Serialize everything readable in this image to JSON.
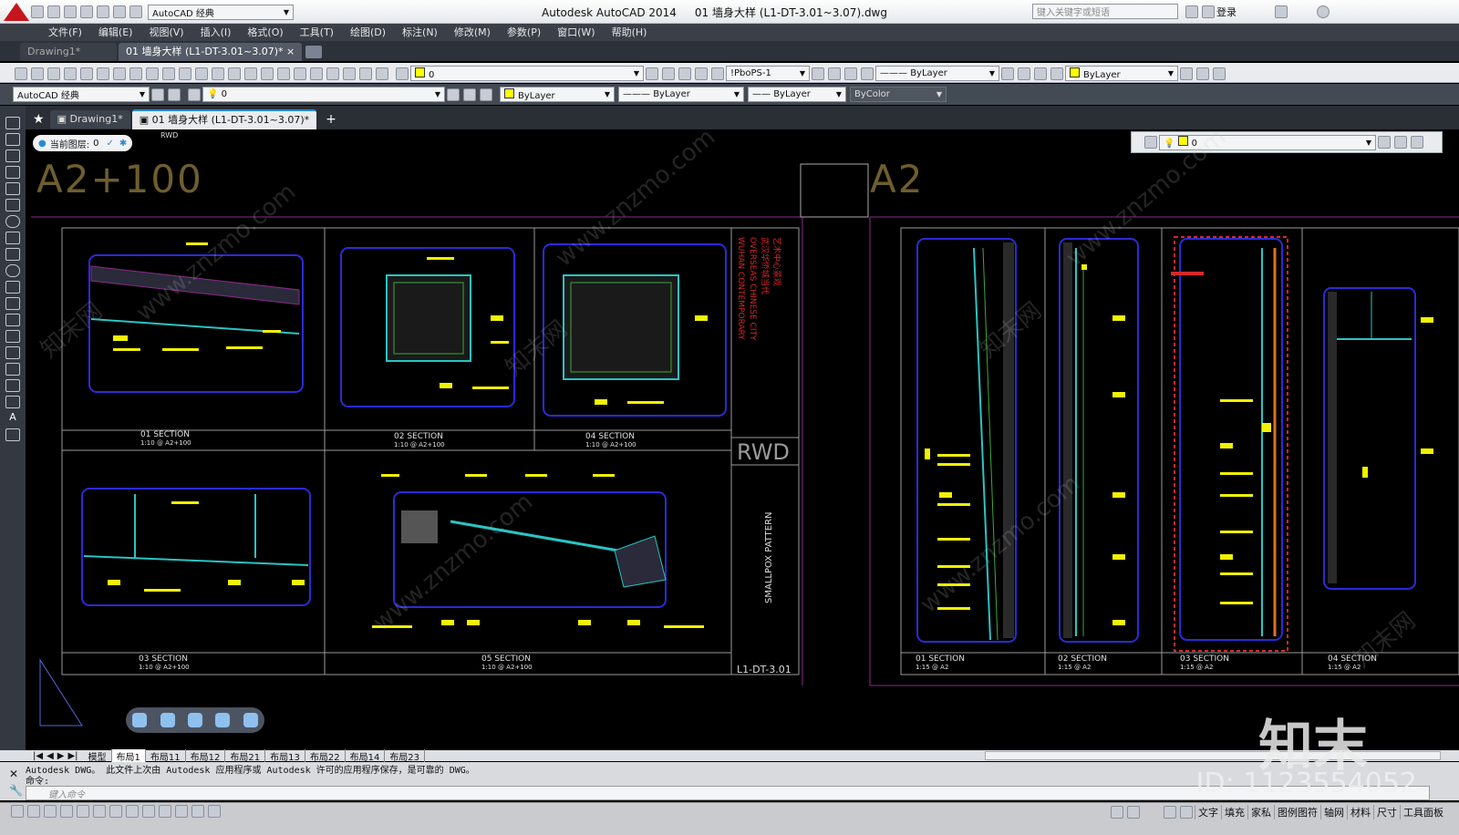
{
  "titlebar": {
    "workspace": "AutoCAD 经典",
    "app_title": "Autodesk AutoCAD 2014",
    "file_title": "01 墙身大样 (L1-DT-3.01~3.07).dwg",
    "search_placeholder": "键入关键字或短语",
    "login": "登录"
  },
  "menu": [
    "文件(F)",
    "编辑(E)",
    "视图(V)",
    "插入(I)",
    "格式(O)",
    "工具(T)",
    "绘图(D)",
    "标注(N)",
    "修改(M)",
    "参数(P)",
    "窗口(W)",
    "帮助(H)"
  ],
  "doc_tabs": [
    "Drawing1*",
    "01 墙身大样 (L1-DT-3.01~3.07)*"
  ],
  "toolbar1": {
    "layer_value": "0",
    "plotstyle": "!PboPS-1",
    "linetype": "ByLayer",
    "color": "ByLayer"
  },
  "toolbar2": {
    "workspace": "AutoCAD 经典",
    "layer_value": "0",
    "color": "ByLayer",
    "linetype": "ByLayer",
    "lineweight": "ByLayer",
    "plotstyle": "ByColor"
  },
  "file_tabs": [
    "Drawing1*",
    "01 墙身大样 (L1-DT-3.01~3.07)*",
    "+"
  ],
  "current_layer": {
    "label": "当前图层:",
    "value": "0",
    "rwd": "RWD"
  },
  "floating_layer": {
    "value": "0"
  },
  "drawing": {
    "left_sheet_title": "A2+100",
    "right_sheet_title": "A2",
    "left_sections": [
      {
        "label": "01 SECTION",
        "scale": "1:10 @ A2+100"
      },
      {
        "label": "02 SECTION",
        "scale": "1:10 @ A2+100"
      },
      {
        "label": "04 SECTION",
        "scale": "1:10 @ A2+100"
      },
      {
        "label": "03 SECTION",
        "scale": "1:10 @ A2+100"
      },
      {
        "label": "05 SECTION",
        "scale": "1:10 @ A2+100"
      }
    ],
    "sheet_number": "L1-DT-3.01",
    "title_block_text": "SMALLPOX PATTERN",
    "title_logo": "RWD",
    "right_sections": [
      {
        "label": "01 SECTION",
        "scale": "1:15 @ A2"
      },
      {
        "label": "02 SECTION",
        "scale": "1:15 @ A2"
      },
      {
        "label": "03 SECTION",
        "scale": "1:15 @ A2"
      },
      {
        "label": "04 SECTION",
        "scale": "1:15 @ A2"
      }
    ],
    "watermark": "www.znzmo.com",
    "watermark_cn": "知末网"
  },
  "layout_tabs": [
    "模型",
    "布局1",
    "布局11",
    "布局12",
    "布局21",
    "布局13",
    "布局22",
    "布局14",
    "布局23"
  ],
  "command": {
    "history1": "Autodesk DWG。  此文件上次由 Autodesk 应用程序或 Autodesk 许可的应用程序保存，是可靠的 DWG。",
    "history2": "命令:",
    "input_placeholder": "键入命令"
  },
  "status_right": [
    "文字",
    "填充",
    "家私",
    "图例图符",
    "轴网",
    "材料",
    "尺寸",
    "工具面板"
  ],
  "overlay": {
    "logo": "知末",
    "id": "ID: 1123554052"
  },
  "colors": {
    "canvas": "#000000",
    "accent_red": "#d62828",
    "cad_blue": "#2b2bd6",
    "cad_yellow": "#f2f200"
  }
}
